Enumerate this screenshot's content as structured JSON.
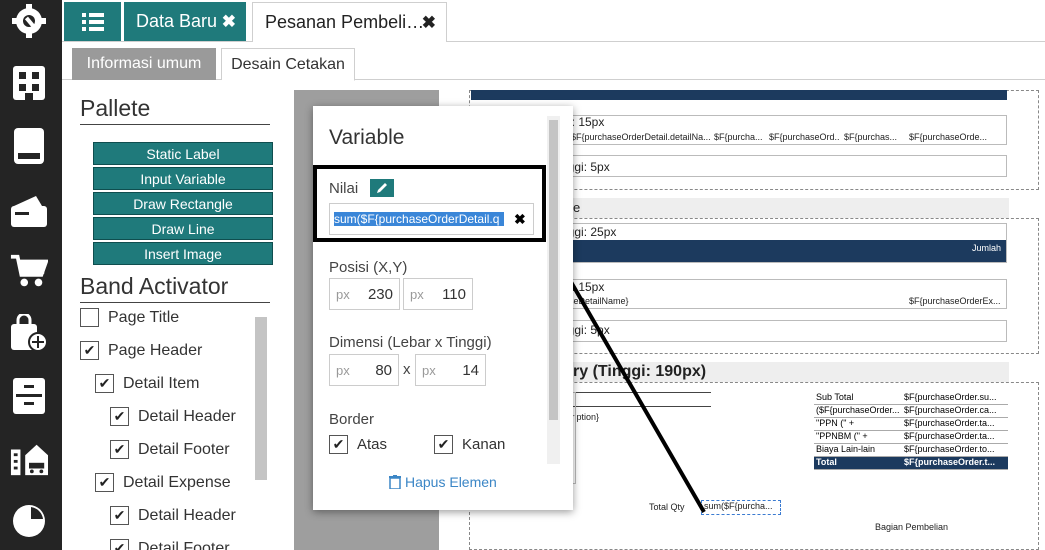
{
  "sidebar": {
    "icons": [
      "settings-icon",
      "building-icon",
      "book-icon",
      "wallet-icon",
      "cart-icon",
      "bag-add-icon",
      "archive-icon",
      "city-icon",
      "chart-pie-icon"
    ]
  },
  "tabs": {
    "tab1": "Data Baru",
    "tab2": "Pesanan Pembeli…",
    "close": "✖"
  },
  "subtabs": {
    "general": "Informasi umum",
    "print_design": "Desain Cetakan"
  },
  "palette": {
    "title": "Pallete",
    "buttons": [
      "Static Label",
      "Input Variable",
      "Draw Rectangle",
      "Draw Line",
      "Insert Image"
    ],
    "band_title": "Band Activator",
    "bands": [
      {
        "label": "Page Title",
        "checked": false
      },
      {
        "label": "Page Header",
        "checked": true
      },
      {
        "label": "Detail Item",
        "checked": true
      },
      {
        "label": "Detail Header",
        "checked": true
      },
      {
        "label": "Detail Footer",
        "checked": true
      },
      {
        "label": "Detail Expense",
        "checked": true
      },
      {
        "label": "Detail Header",
        "checked": true
      },
      {
        "label": "Detail Footer",
        "checked": true
      }
    ]
  },
  "popup": {
    "title": "Variable",
    "value_label": "Nilai",
    "value": "sum($F{purchaseOrderDetail.q",
    "position_label": "Posisi (X,Y)",
    "unit": "px",
    "x": "230",
    "y": "110",
    "dimension_label": "Dimensi (Lebar x Tinggi)",
    "times": "x",
    "width": "80",
    "height": "14",
    "border_label": "Border",
    "border_top": "Atas",
    "border_right": "Kanan",
    "delete_label": "Hapus Elemen"
  },
  "report": {
    "t1": "i: 15px",
    "t2": "nggi: 5px",
    "t3": "e",
    "t4": "nggi: 25px",
    "jumlah": "Jumlah",
    "t5": "i: 15px",
    "t6": "nggi: 5px",
    "t7": "ry (Tinggi: 190px)",
    "detail_row": [
      "$F{purchaseOrderDetail.detailNa...",
      "$F{purcha...",
      "$F{purchaseOrd...",
      "$F{purchas...",
      "$F{purchaseOrde..."
    ],
    "exp_row1": "seDetailName}",
    "exp_row2": "$F{purchaseOrderEx...",
    "cription": "cription}",
    "total_qty": "Total Qty",
    "sum_box": "sum($F{purcha...",
    "dept": "Bagian Pembelian",
    "summary": [
      [
        "Sub Total",
        "$F{purchaseOrder.su..."
      ],
      [
        "($F{purchaseOrder...",
        "$F{purchaseOrder.ca..."
      ],
      [
        "\"PPN (\" +",
        "$F{purchaseOrder.ta..."
      ],
      [
        "\"PPNBM (\" +",
        "$F{purchaseOrder.ta..."
      ],
      [
        "Biaya Lain-lain",
        "$F{purchaseOrder.to..."
      ],
      [
        "Total",
        "$F{purchaseOrder.t..."
      ]
    ]
  }
}
